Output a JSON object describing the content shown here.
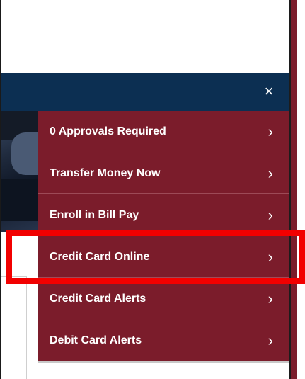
{
  "header": {
    "close_label": "×"
  },
  "menu": {
    "items": [
      {
        "label": "0 Approvals Required",
        "chevron": "›"
      },
      {
        "label": "Transfer Money Now",
        "chevron": "›"
      },
      {
        "label": "Enroll in Bill Pay",
        "chevron": "›"
      },
      {
        "label": "Credit Card Online",
        "chevron": "›"
      },
      {
        "label": "Credit Card Alerts",
        "chevron": "›"
      },
      {
        "label": "Debit Card Alerts",
        "chevron": "›"
      }
    ]
  },
  "highlight": {
    "target": "Credit Card Online",
    "color": "#f20000"
  },
  "colors": {
    "header": "#0c2f52",
    "menu": "#7b1c2b"
  }
}
